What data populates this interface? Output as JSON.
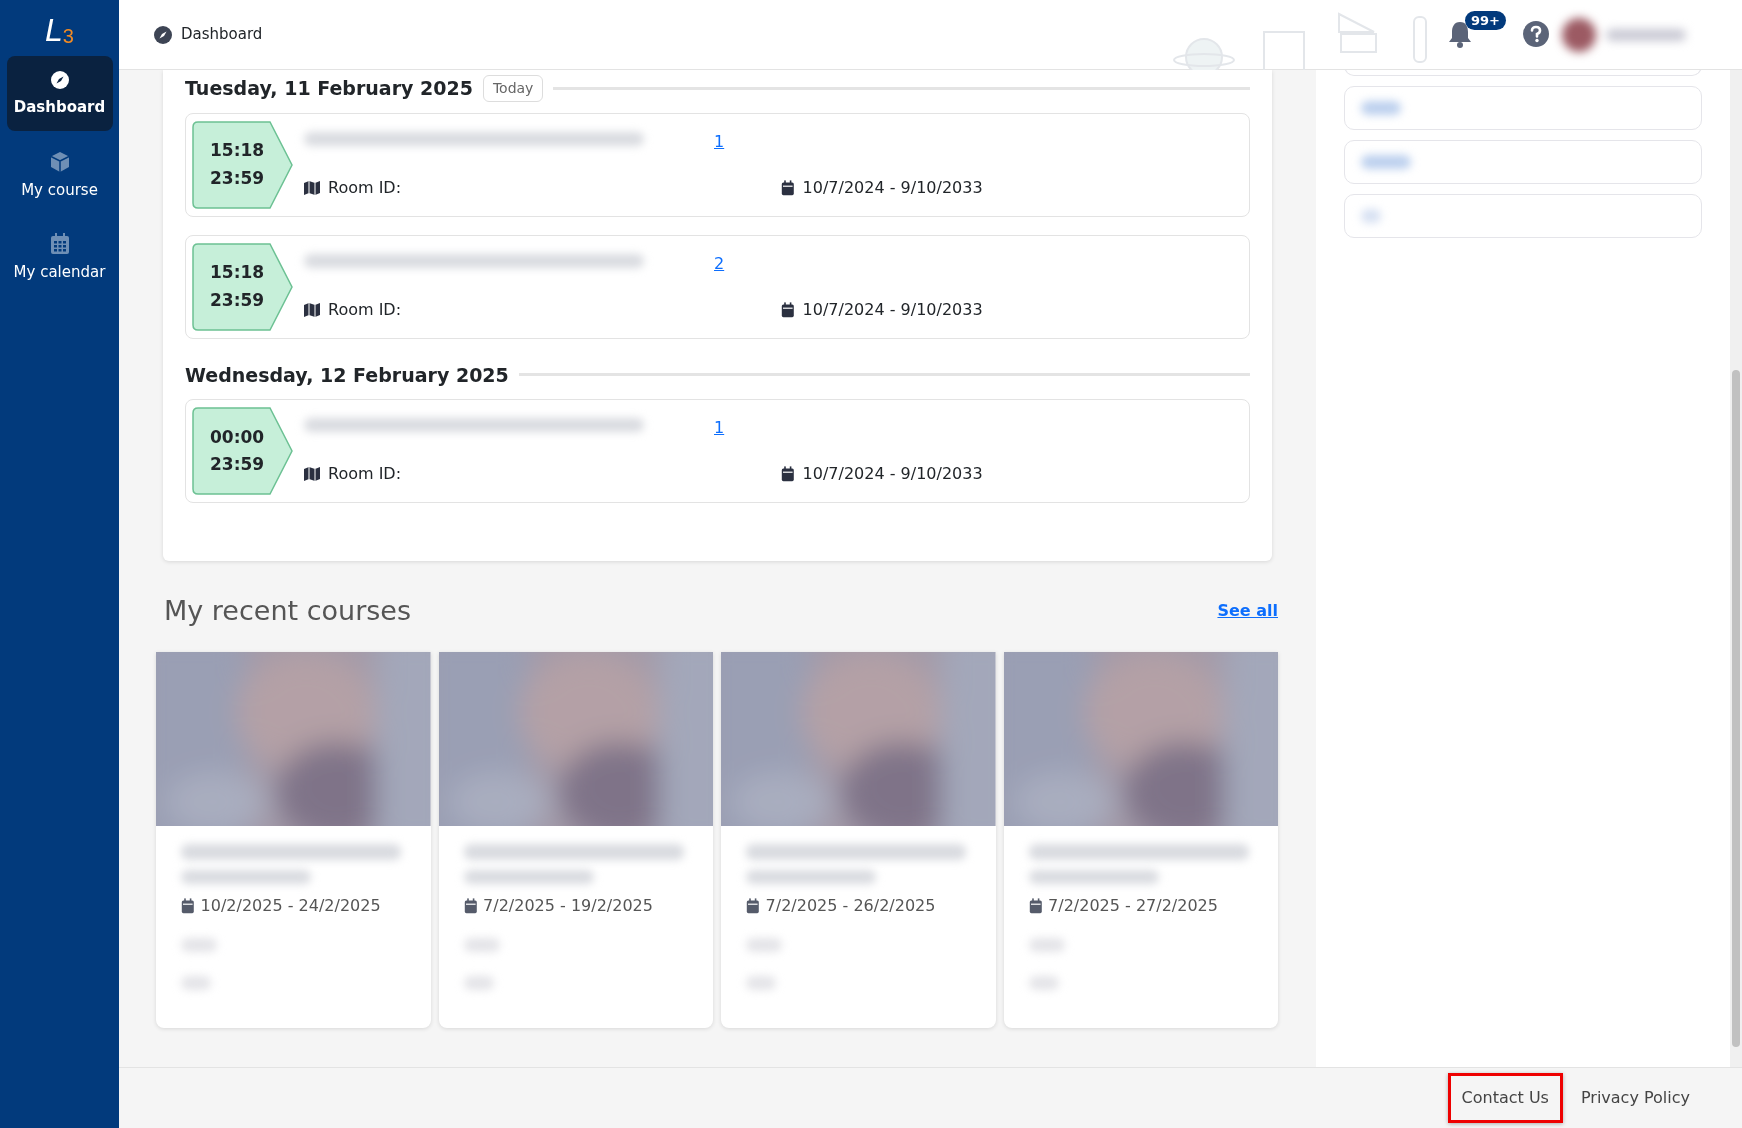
{
  "sidebar": {
    "logo": {
      "letter": "L",
      "digit": "3"
    },
    "items": [
      {
        "label": "Dashboard",
        "selected": true
      },
      {
        "label": "My course",
        "selected": false
      },
      {
        "label": "My calendar",
        "selected": false
      }
    ]
  },
  "topbar": {
    "breadcrumb": "Dashboard",
    "notification_count": "99+"
  },
  "schedule": {
    "days": [
      {
        "date": "Tuesday, 11 February 2025",
        "today_badge": "Today",
        "events": [
          {
            "start": "15:18",
            "end": "23:59",
            "link": "1",
            "room_label": "Room ID:",
            "dates": "10/7/2024 - 9/10/2033"
          },
          {
            "start": "15:18",
            "end": "23:59",
            "link": "2",
            "room_label": "Room ID:",
            "dates": "10/7/2024 - 9/10/2033"
          }
        ]
      },
      {
        "date": "Wednesday, 12 February 2025",
        "events": [
          {
            "start": "00:00",
            "end": "23:59",
            "link": "1",
            "room_label": "Room ID:",
            "dates": "10/7/2024 - 9/10/2033"
          }
        ]
      }
    ]
  },
  "recent_courses": {
    "title": "My recent courses",
    "see_all": "See all",
    "courses": [
      {
        "dates": "10/2/2025 - 24/2/2025"
      },
      {
        "dates": "7/2/2025 - 19/2/2025"
      },
      {
        "dates": "7/2/2025 - 26/2/2025"
      },
      {
        "dates": "7/2/2025 - 27/2/2025"
      }
    ]
  },
  "footer": {
    "links": [
      {
        "label": "Contact Us",
        "highlighted": true
      },
      {
        "label": "Privacy Policy",
        "highlighted": false
      }
    ]
  }
}
